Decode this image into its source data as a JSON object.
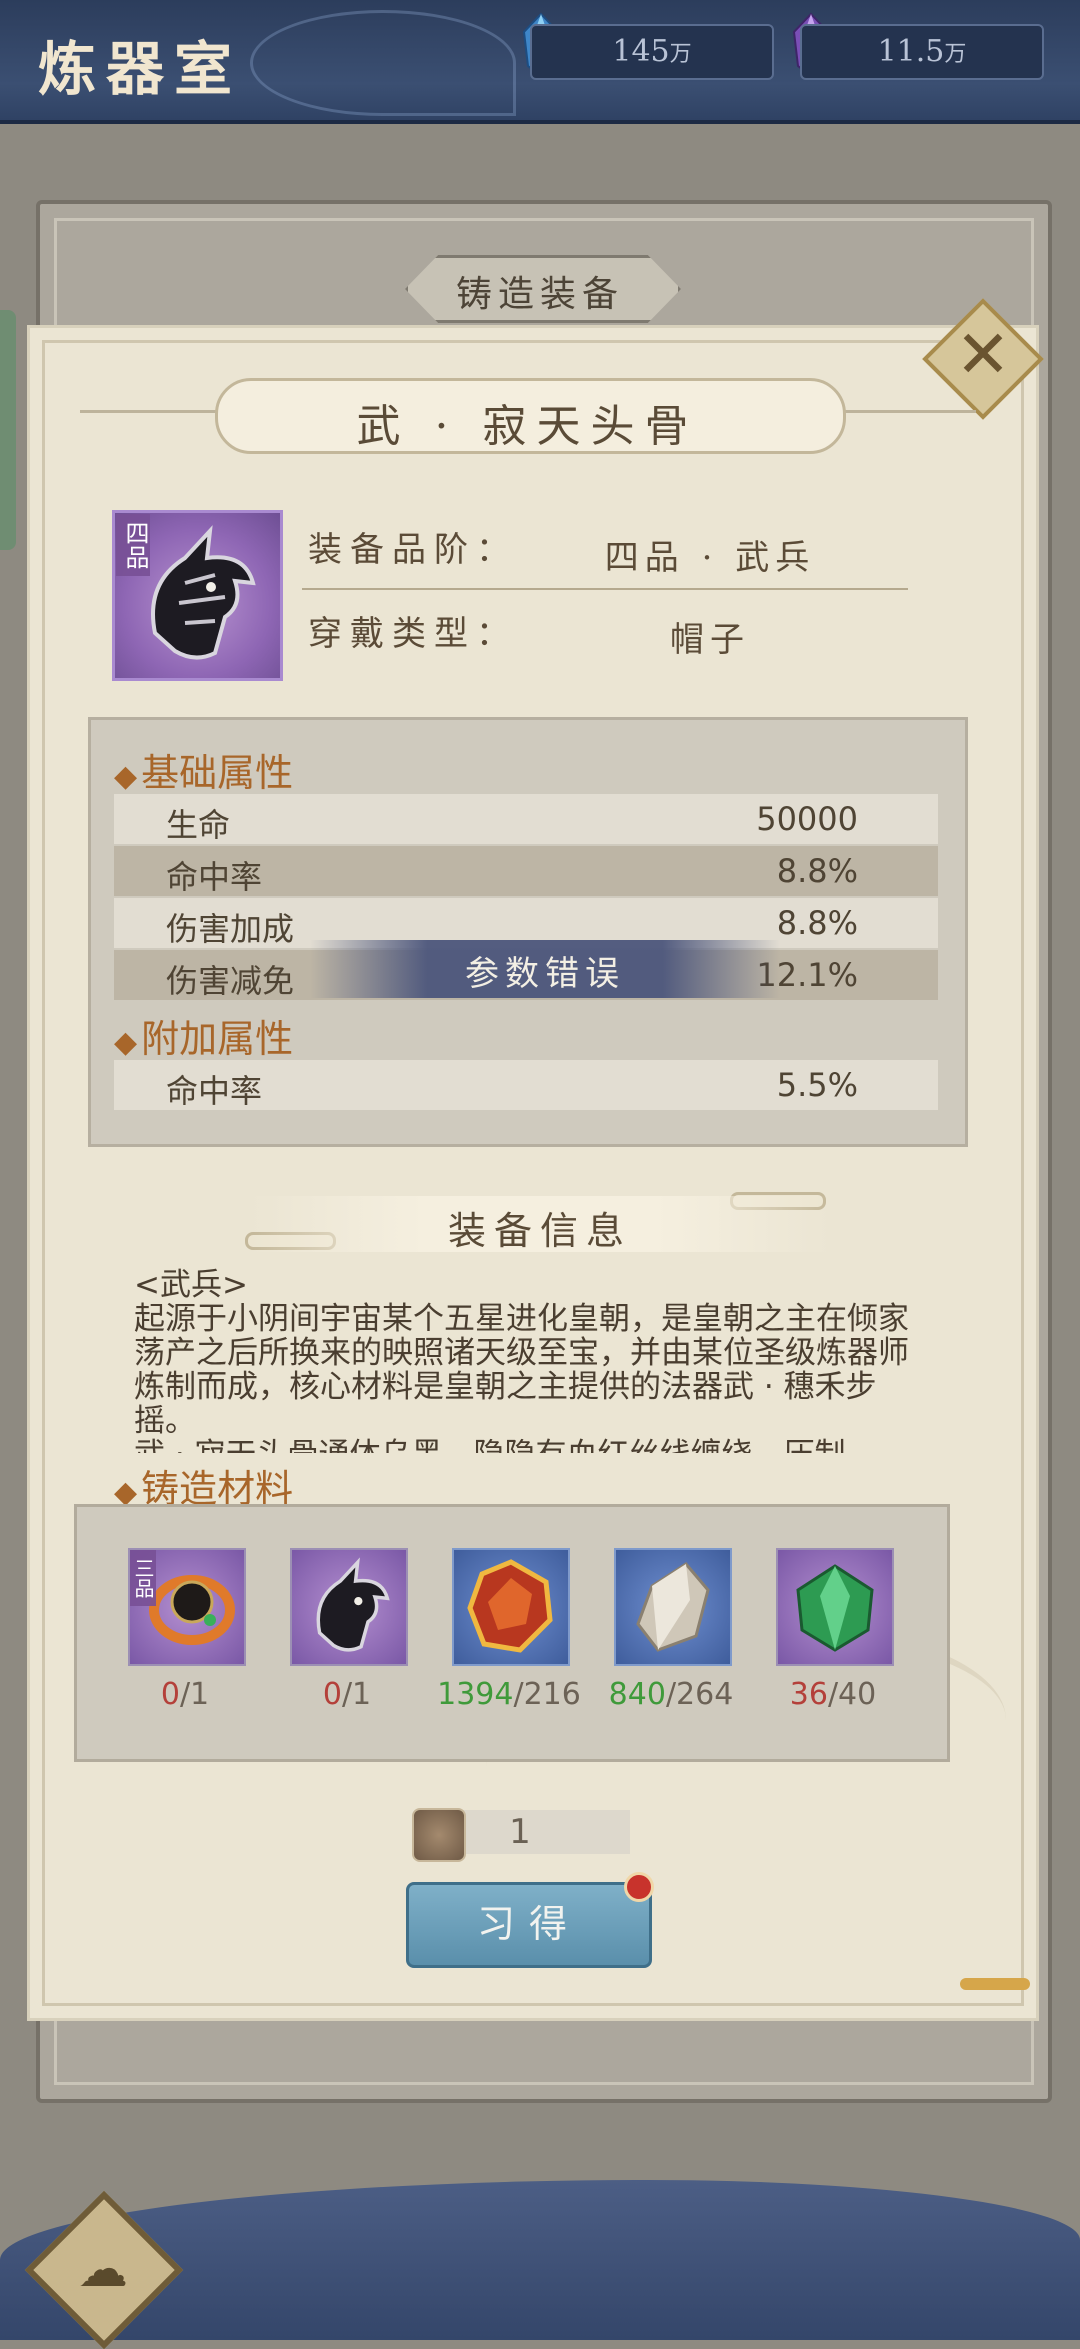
{
  "header": {
    "title": "炼器室",
    "resources": [
      {
        "icon": "blue-crystal-icon",
        "amount": "145",
        "unit": "万"
      },
      {
        "icon": "purple-crystal-icon",
        "amount": "11.5",
        "unit": "万"
      }
    ]
  },
  "tab_label": "铸造装备",
  "equipment": {
    "name": "武 · 寂天头骨",
    "icon": "dragon-skull-helmet-icon",
    "grade_tag": "四品",
    "rows": [
      {
        "label": "装备品阶：",
        "value": "四品 · 武兵"
      },
      {
        "label": "穿戴类型：",
        "value": "帽子"
      }
    ]
  },
  "base_attributes": {
    "title": "基础属性",
    "rows": [
      {
        "label": "生命",
        "value": "50000"
      },
      {
        "label": "命中率",
        "value": "8.8%"
      },
      {
        "label": "伤害加成",
        "value": "8.8%"
      },
      {
        "label": "伤害减免",
        "value": "12.1%"
      }
    ]
  },
  "extra_attributes": {
    "title": "附加属性",
    "rows": [
      {
        "label": "命中率",
        "value": "5.5%"
      }
    ]
  },
  "toast": "参数错误",
  "info": {
    "title": "装备信息",
    "text": "<武兵>\n起源于小阴间宇宙某个五星进化皇朝，是皇朝之主在倾家荡产之后所换来的映照诸天级至宝，并由某位圣级炼器师炼制而成，核心材料是皇朝之主提供的法器武 · 穗禾步摇。\n武 · 寂天头骨通体乌黑，隐隐有血红丝线缠绕，压制"
  },
  "materials": {
    "title": "铸造材料",
    "items": [
      {
        "icon": "black-ring-icon",
        "grade_tag": "三品",
        "have": "0",
        "need": "/1",
        "status": "red"
      },
      {
        "icon": "dragon-skull-helmet-icon",
        "grade_tag": "",
        "have": "0",
        "need": "/1",
        "status": "red"
      },
      {
        "icon": "red-ore-icon",
        "grade_tag": "",
        "have": "1394",
        "need": "/216",
        "status": "green"
      },
      {
        "icon": "silver-ore-icon",
        "grade_tag": "",
        "have": "840",
        "need": "/264",
        "status": "green"
      },
      {
        "icon": "green-gem-icon",
        "grade_tag": "",
        "have": "36",
        "need": "/40",
        "status": "red"
      }
    ]
  },
  "craft": {
    "count": "1",
    "button_label": "习得"
  },
  "colors": {
    "accent": "#a8662a",
    "have_red": "#b4403a",
    "have_green": "#3f9a3a",
    "button": "#5a8fab"
  }
}
